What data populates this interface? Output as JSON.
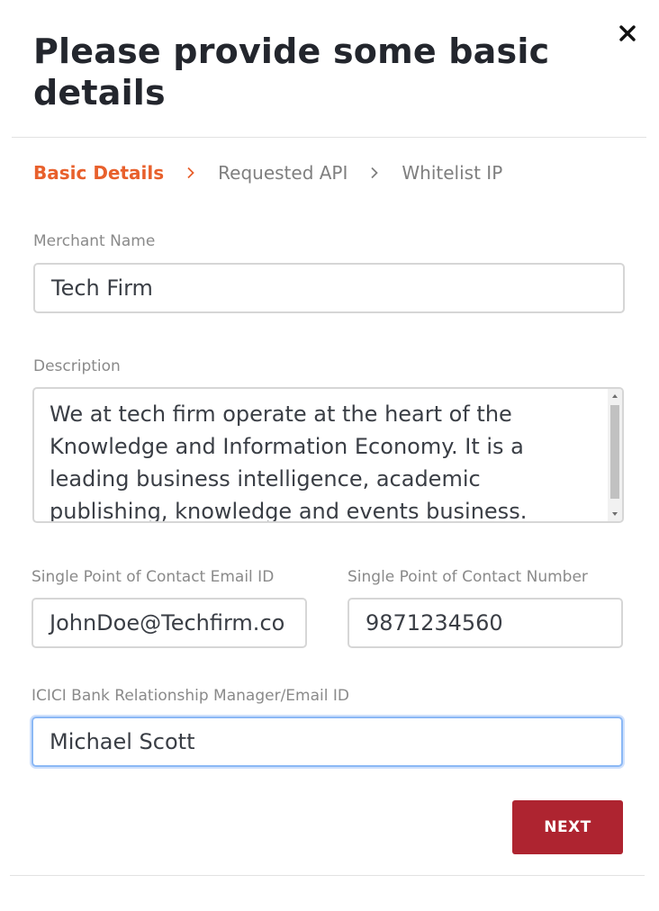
{
  "dialog": {
    "title": "Please provide some basic details",
    "close_icon": "close-icon"
  },
  "steps": {
    "items": [
      {
        "label": "Basic Details",
        "active": true
      },
      {
        "label": "Requested API",
        "active": false
      },
      {
        "label": "Whitelist IP",
        "active": false
      }
    ],
    "separator_icon": "chevron-right-icon",
    "active_color": "#e8602c",
    "inactive_color": "#7f7f7f"
  },
  "form": {
    "merchant_name": {
      "label": "Merchant Name",
      "value": "Tech Firm"
    },
    "description": {
      "label": "Description",
      "value": "We at tech firm operate at the heart of the Knowledge and Information Economy. It is a leading business intelligence, academic publishing, knowledge and events business."
    },
    "contact_email": {
      "label": "Single Point of Contact Email ID",
      "value": "JohnDoe@Techfirm.co"
    },
    "contact_number": {
      "label": "Single Point of Contact Number",
      "value": "9871234560"
    },
    "relationship_manager": {
      "label": "ICICI Bank Relationship Manager/Email ID",
      "value": "Michael Scott"
    }
  },
  "actions": {
    "next_label": "NEXT",
    "next_color": "#ae2430"
  }
}
